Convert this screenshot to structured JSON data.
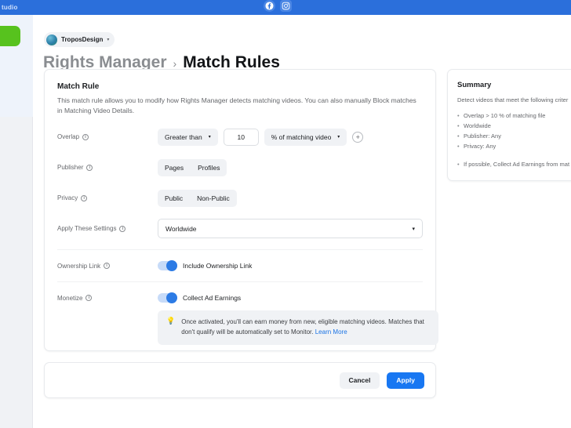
{
  "topbar": {
    "brand_partial": "tudio",
    "icons": [
      "facebook-icon",
      "instagram-icon"
    ],
    "color": "#2b6fdb"
  },
  "sidebar": {
    "green_button_label": "",
    "accent": "#57c21e"
  },
  "account": {
    "name": "TroposDesign",
    "caret": "▾"
  },
  "breadcrumb": {
    "parent": "Rights Manager",
    "separator": "›",
    "current": "Match Rules"
  },
  "card": {
    "title": "Match Rule",
    "description": "This match rule allows you to modify how Rights Manager detects matching videos. You can also manually Block matches in Matching Video Details.",
    "rows": {
      "overlap": {
        "label": "Overlap",
        "operator": "Greater than",
        "value": "10",
        "unit": "% of matching video",
        "add": "+"
      },
      "publisher": {
        "label": "Publisher",
        "options": [
          "Pages",
          "Profiles"
        ]
      },
      "privacy": {
        "label": "Privacy",
        "options": [
          "Public",
          "Non-Public"
        ]
      },
      "apply_settings": {
        "label": "Apply These Settings",
        "value": "Worldwide",
        "caret": "▾"
      },
      "ownership_link": {
        "label": "Ownership Link",
        "toggle_label": "Include Ownership Link",
        "toggle_on": true
      },
      "monetize": {
        "label": "Monetize",
        "toggle_label": "Collect Ad Earnings",
        "toggle_on": true
      }
    },
    "callout": {
      "icon": "lightbulb-icon",
      "text": "Once activated, you'll can earn money from new, eligible matching videos. Matches that don't qualify will be automatically set to Monitor.",
      "link": "Learn More"
    }
  },
  "summary": {
    "title": "Summary",
    "description": "Detect videos that meet the following criter",
    "items": [
      "Overlap > 10 % of matching file",
      "Worldwide",
      "Publisher: Any",
      "Privacy: Any"
    ],
    "extra": [
      "If possible, Collect Ad Earnings from mat"
    ]
  },
  "actions": {
    "cancel": "Cancel",
    "apply": "Apply",
    "apply_color": "#1877f2"
  }
}
